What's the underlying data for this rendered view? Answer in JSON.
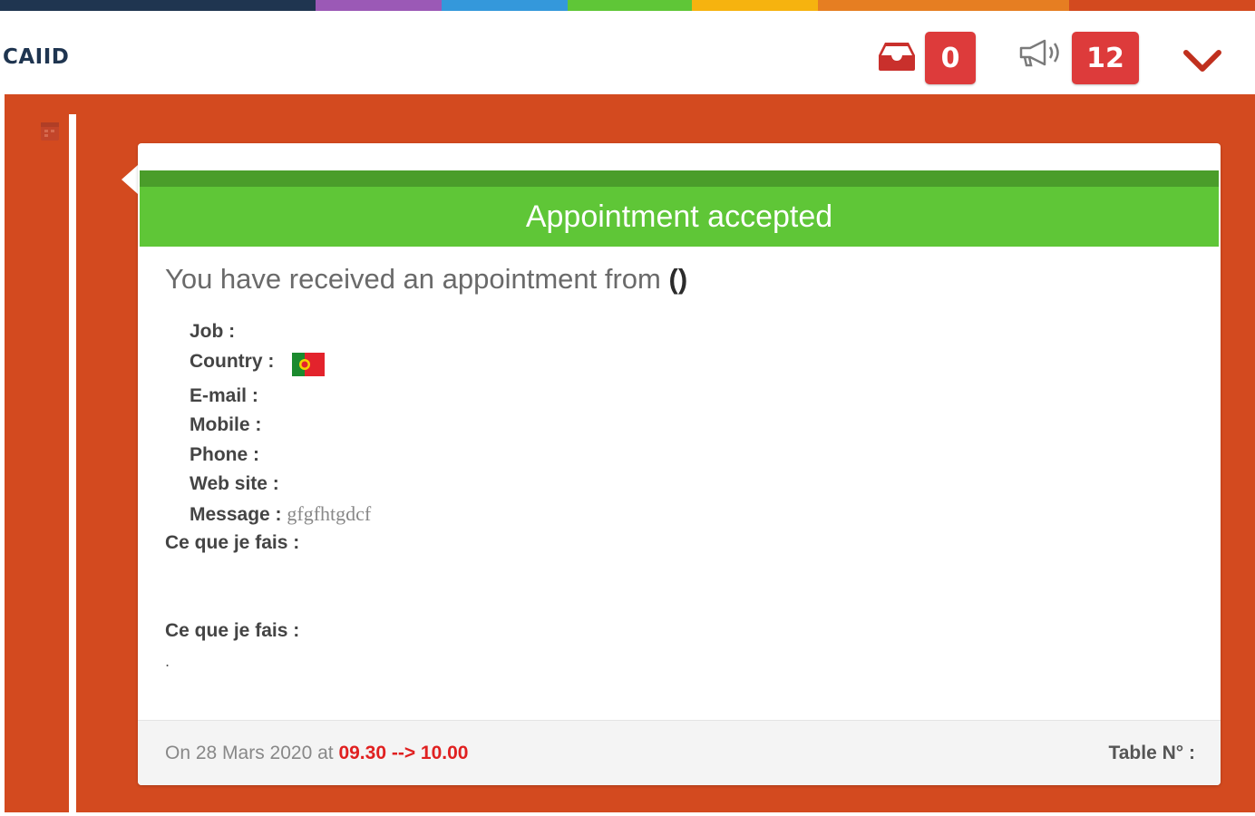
{
  "header": {
    "brand": "CAIID",
    "inbox_count": "0",
    "notification_count": "12"
  },
  "colors": {
    "strip": [
      "#1f3550",
      "#9b59b6",
      "#3498db",
      "#5fc637",
      "#f6b30f",
      "#e67e22",
      "#d34a1f"
    ],
    "accent_bg": "#d34a1f",
    "success": "#5fc637",
    "badge": "#dd3b3b"
  },
  "icons": {
    "inbox": "inbox-icon",
    "megaphone": "megaphone-icon",
    "dropdown": "chevron-down-icon",
    "calendar": "calendar-icon",
    "flag": "portugal-flag-icon"
  },
  "card": {
    "title": "Appointment accepted",
    "intro_text": "You have received an appointment from",
    "intro_paren": "()",
    "fields": {
      "job": "Job :",
      "country": "Country :",
      "email": "E-mail :",
      "mobile": "Mobile :",
      "phone": "Phone :",
      "website": "Web site :",
      "message_label": "Message :",
      "message_value": "gfgfhtgdcf"
    },
    "section1_label": "Ce que je fais :",
    "section2_label": "Ce que je fais :",
    "section2_value": ".",
    "footer": {
      "date_prefix": "On 28 Mars 2020 at",
      "time_range": "09.30 --> 10.00",
      "table_label": "Table N° :"
    }
  }
}
